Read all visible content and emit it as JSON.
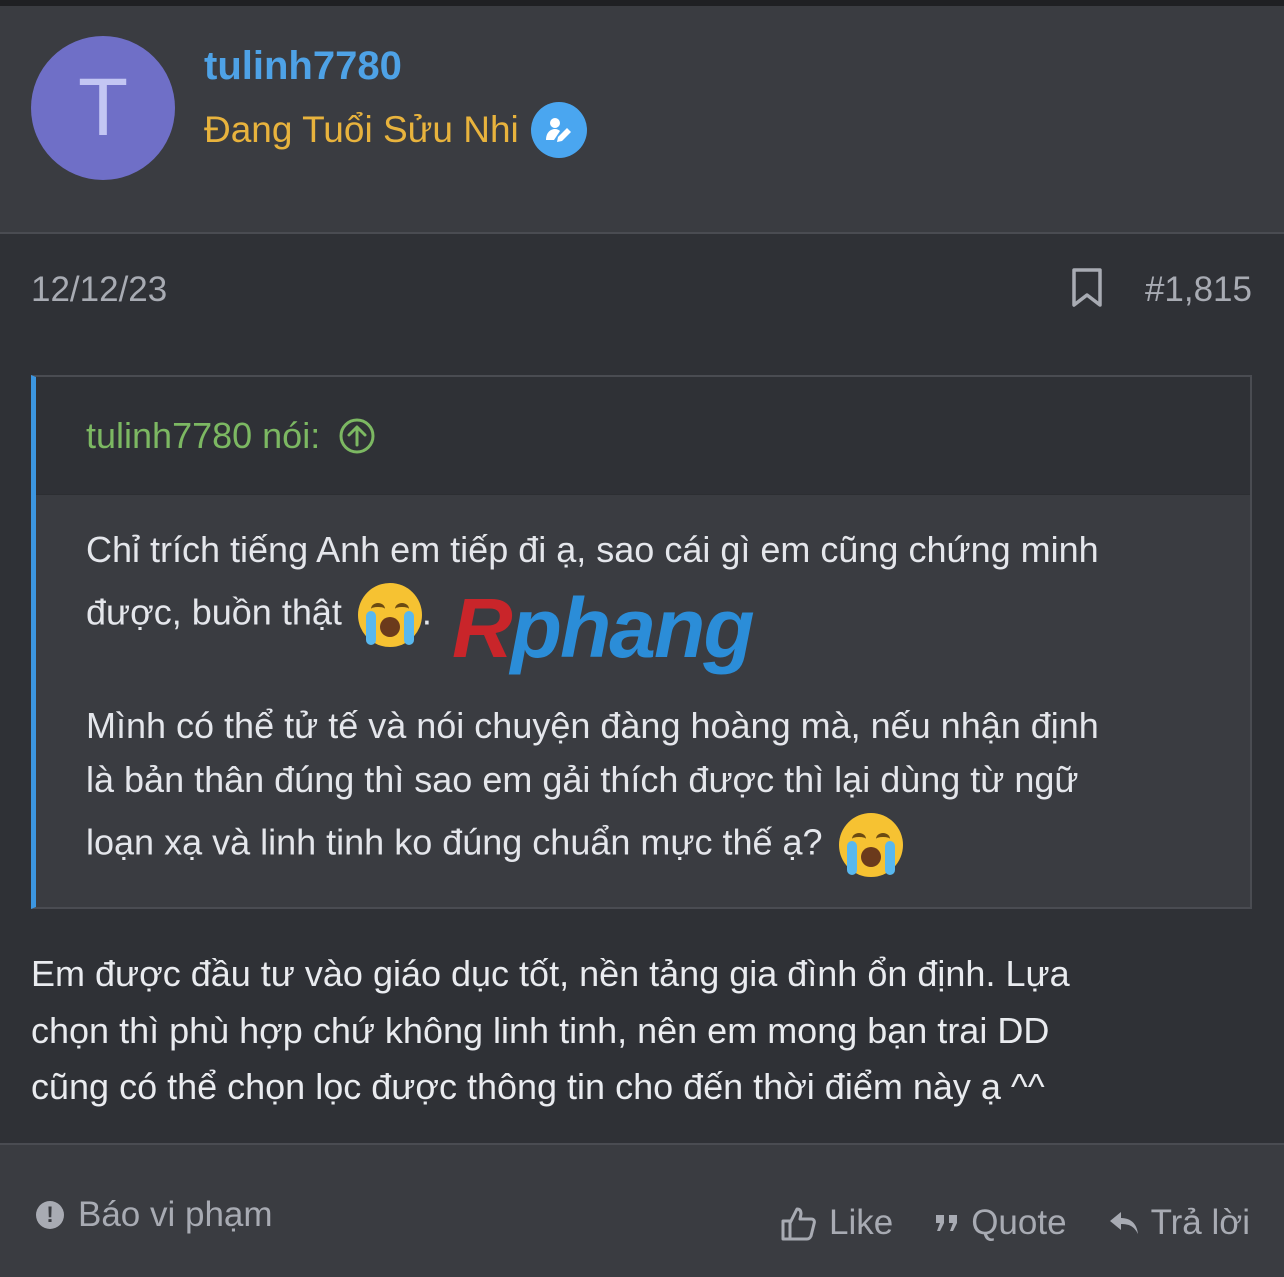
{
  "user": {
    "avatar_letter": "T",
    "name": "tulinh7780",
    "title": "Đang Tuổi Sửu Nhi"
  },
  "post": {
    "date": "12/12/23",
    "number": "#1,815",
    "body_lines": [
      "Em được đầu tư vào giáo dục tốt, nền tảng gia đình ổn định. Lựa",
      "chọn thì phù hợp chứ không linh tinh, nên em mong bạn trai DD",
      "cũng có thể chọn lọc được thông tin cho đến thời điểm này ạ ^^"
    ]
  },
  "quote": {
    "author": "tulinh7780 nói:",
    "line1": "Chỉ trích tiếng Anh em tiếp đi ạ, sao cái gì em cũng chứng minh",
    "line2": "được, buồn thật",
    "line2_tail": ".",
    "line3": "Mình có thể tử tế và nói chuyện đàng hoàng mà, nếu nhận định",
    "line4": "là bản thân đúng thì sao em gải thích được thì lại dùng từ ngữ",
    "line5": "loạn xạ và linh tinh ko đúng chuẩn mực thế ạ?"
  },
  "watermark": {
    "part1": "R",
    "part2": "phang"
  },
  "footer": {
    "report": "Báo vi phạm",
    "like": "Like",
    "quote": "Quote",
    "reply": "Trả lời"
  },
  "colors": {
    "username": "#4ea2e6",
    "title": "#e8b33d",
    "quote_author": "#7cb862",
    "quote_bar": "#3c96e0"
  }
}
